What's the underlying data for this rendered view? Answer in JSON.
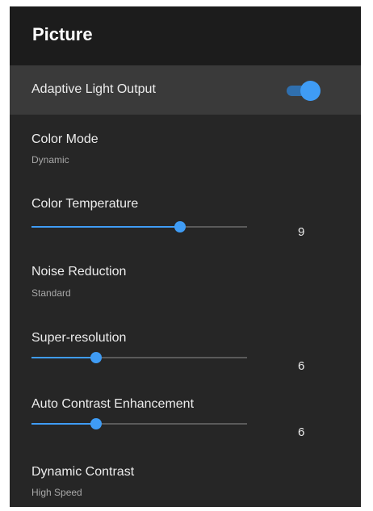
{
  "header": {
    "title": "Picture"
  },
  "accent_color": "#3f9cf5",
  "settings": {
    "adaptive_light_output": {
      "label": "Adaptive Light Output",
      "enabled": true
    },
    "color_mode": {
      "label": "Color Mode",
      "value": "Dynamic"
    },
    "color_temperature": {
      "label": "Color Temperature",
      "value": "9",
      "slider_fraction": 0.69
    },
    "noise_reduction": {
      "label": "Noise Reduction",
      "value": "Standard"
    },
    "super_resolution": {
      "label": "Super-resolution",
      "value": "6",
      "slider_fraction": 0.3
    },
    "auto_contrast_enhancement": {
      "label": "Auto Contrast Enhancement",
      "value": "6",
      "slider_fraction": 0.3
    },
    "dynamic_contrast": {
      "label": "Dynamic Contrast",
      "value": "High Speed"
    }
  }
}
